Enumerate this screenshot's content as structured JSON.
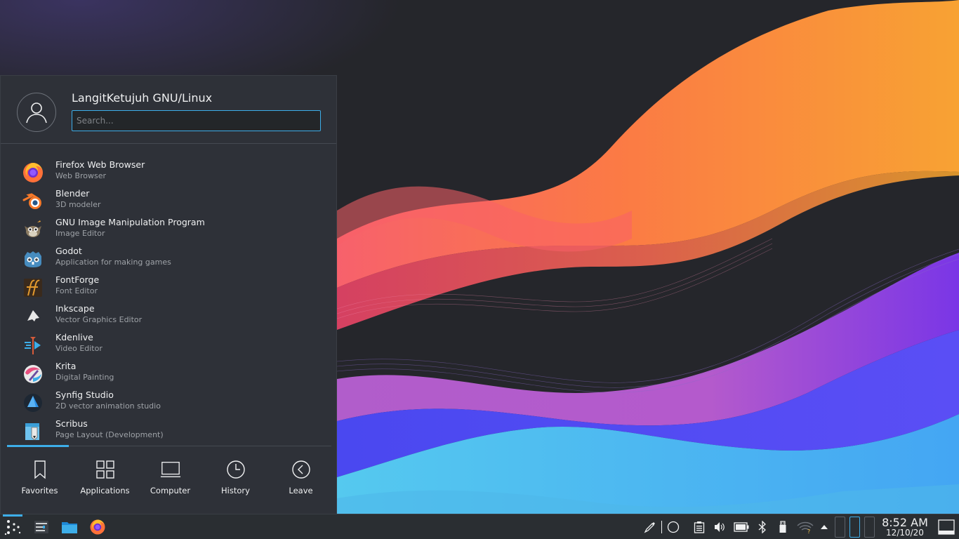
{
  "menu": {
    "user_name": "LangitKetujuh GNU/Linux",
    "search_placeholder": "Search...",
    "apps": [
      {
        "name": "Firefox Web Browser",
        "desc": "Web Browser",
        "icon": "firefox-icon"
      },
      {
        "name": "Blender",
        "desc": "3D modeler",
        "icon": "blender-icon"
      },
      {
        "name": "GNU Image Manipulation Program",
        "desc": "Image Editor",
        "icon": "gimp-icon"
      },
      {
        "name": "Godot",
        "desc": "Application for making games",
        "icon": "godot-icon"
      },
      {
        "name": "FontForge",
        "desc": "Font Editor",
        "icon": "fontforge-icon"
      },
      {
        "name": "Inkscape",
        "desc": "Vector Graphics Editor",
        "icon": "inkscape-icon"
      },
      {
        "name": "Kdenlive",
        "desc": "Video Editor",
        "icon": "kdenlive-icon"
      },
      {
        "name": "Krita",
        "desc": "Digital Painting",
        "icon": "krita-icon"
      },
      {
        "name": "Synfig Studio",
        "desc": "2D vector animation studio",
        "icon": "synfig-icon"
      },
      {
        "name": "Scribus",
        "desc": "Page Layout (Development)",
        "icon": "scribus-icon"
      }
    ],
    "tabs": [
      {
        "label": "Favorites",
        "icon": "bookmark-icon"
      },
      {
        "label": "Applications",
        "icon": "grid-icon"
      },
      {
        "label": "Computer",
        "icon": "laptop-icon"
      },
      {
        "label": "History",
        "icon": "clock-icon"
      },
      {
        "label": "Leave",
        "icon": "back-arrow-icon"
      }
    ],
    "active_tab": "Favorites"
  },
  "panel": {
    "time": "8:52 AM",
    "date": "12/10/20",
    "accent": "#3daee9",
    "tasks": [
      "application-launcher-icon",
      "system-settings-icon",
      "file-manager-icon",
      "firefox-icon"
    ],
    "tray": [
      "color-picker-icon",
      "circle-icon",
      "clipboard-icon",
      "volume-icon",
      "battery-icon",
      "bluetooth-icon",
      "usb-drive-icon",
      "wifi-icon",
      "expand-arrow-icon"
    ]
  }
}
